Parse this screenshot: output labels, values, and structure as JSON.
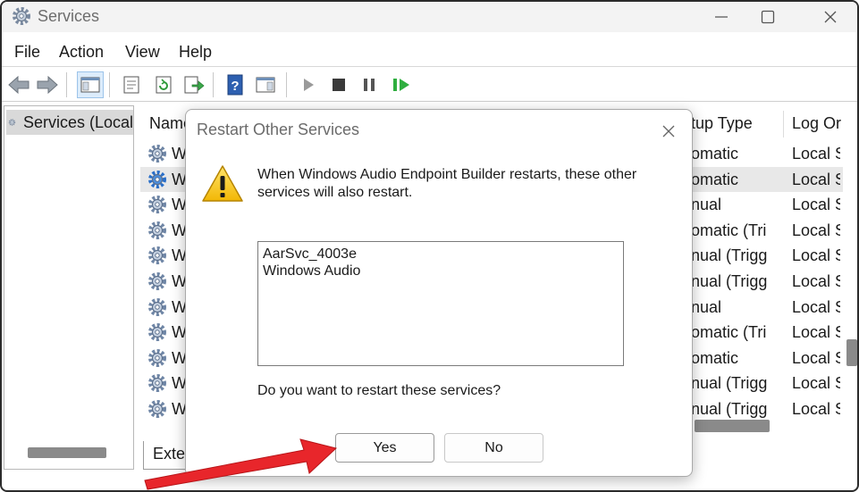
{
  "window": {
    "title": "Services"
  },
  "menu": [
    "File",
    "Action",
    "View",
    "Help"
  ],
  "tree": {
    "root_label": "Services (Local"
  },
  "list": {
    "headers": {
      "name": "Name",
      "startup_type": "tup Type",
      "log_on": "Log Or"
    },
    "rows": [
      {
        "name": "W",
        "startup": "omatic",
        "logon": "Local S"
      },
      {
        "name": "W",
        "startup": "omatic",
        "logon": "Local S"
      },
      {
        "name": "W",
        "startup": "nual",
        "logon": "Local S"
      },
      {
        "name": "W",
        "startup": "omatic (Tri",
        "logon": "Local S"
      },
      {
        "name": "W",
        "startup": "nual (Trigg",
        "logon": "Local S"
      },
      {
        "name": "W",
        "startup": "nual (Trigg",
        "logon": "Local S"
      },
      {
        "name": "W",
        "startup": "nual",
        "logon": "Local S"
      },
      {
        "name": "W",
        "startup": "omatic (Tri",
        "logon": "Local S"
      },
      {
        "name": "W",
        "startup": "omatic",
        "logon": "Local S"
      },
      {
        "name": "W",
        "startup": "nual (Trigg",
        "logon": "Local S"
      },
      {
        "name": "W",
        "startup": "nual (Trigg",
        "logon": "Local S"
      }
    ],
    "tab_extended": "Exter"
  },
  "dialog": {
    "title": "Restart Other Services",
    "message": "When Windows Audio Endpoint Builder restarts, these other services will also restart.",
    "services": [
      "AarSvc_4003e",
      "Windows Audio"
    ],
    "question": "Do you want to restart these services?",
    "yes_label": "Yes",
    "no_label": "No"
  },
  "colors": {
    "arrow": "#e8262b",
    "accent": "#1f6fd0"
  }
}
